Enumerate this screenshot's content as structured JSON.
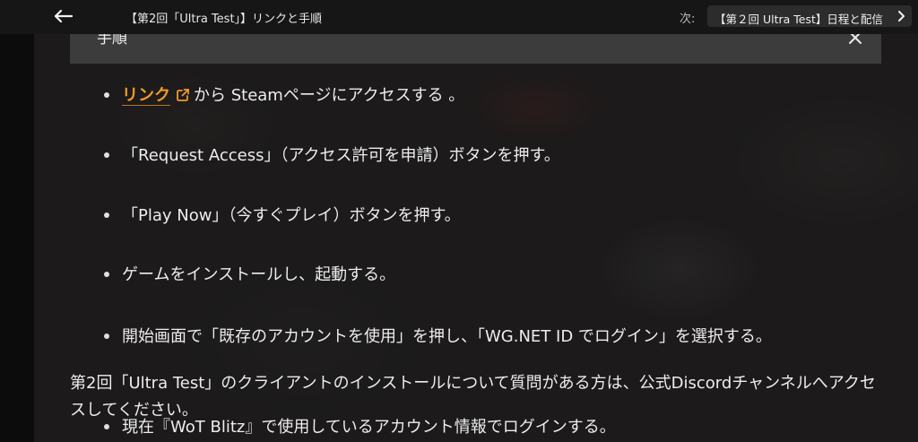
{
  "header": {
    "title": "【第2回「Ultra Test」】リンクと手順",
    "next_label": "次:",
    "next_article": "【第２回 Ultra Test】日程と配信"
  },
  "section": {
    "title": "手順"
  },
  "steps": {
    "link_text": "リンク",
    "step1_rest": "から Steamページにアクセスする 。",
    "step2": "「Request Access」（アクセス許可を申請）ボタンを押す。",
    "step3": "「Play Now」（今すぐプレイ）ボタンを押す。",
    "step4": "ゲームをインストールし、起動する。",
    "step5": "開始画面で「既存のアカウントを使用」を押し、「WG.NET ID でログイン」を選択する。",
    "step6": "現在『WoT Blitz』で使用しているアカウント情報でログインする。"
  },
  "footer_note": "第2回「Ultra Test」のクライアントのインストールについて質問がある方は、公式Discordチャンネルへアクセスしてください。",
  "colors": {
    "link": "#f29b26",
    "accordion_bg": "#3d3c3c",
    "topbar_bg": "#161616"
  }
}
